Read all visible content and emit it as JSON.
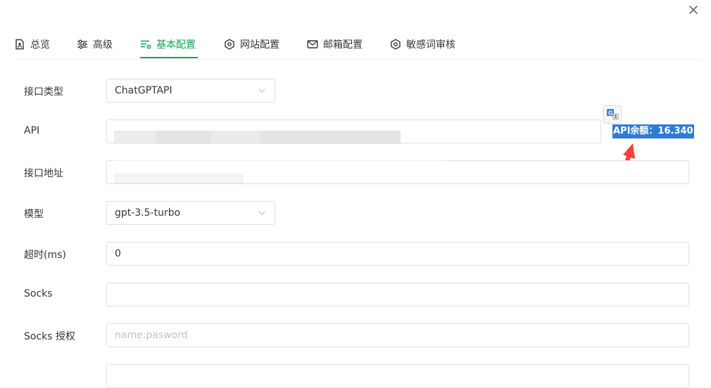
{
  "tabs": [
    {
      "label": "总览",
      "icon": "document-icon"
    },
    {
      "label": "高级",
      "icon": "sliders-icon"
    },
    {
      "label": "基本配置",
      "icon": "settings-list-icon",
      "active": true
    },
    {
      "label": "网站配置",
      "icon": "hexagon-gear-icon"
    },
    {
      "label": "邮箱配置",
      "icon": "mail-icon"
    },
    {
      "label": "敏感词审核",
      "icon": "hexagon-gear-icon"
    }
  ],
  "form": {
    "api_type": {
      "label": "接口类型",
      "value": "ChatGPTAPI"
    },
    "api": {
      "label": "API"
    },
    "endpoint": {
      "label": "接口地址"
    },
    "model": {
      "label": "模型",
      "value": "gpt-3.5-turbo"
    },
    "timeout": {
      "label": "超时(ms)",
      "value": "0"
    },
    "socks": {
      "label": "Socks",
      "value": ""
    },
    "socks_auth": {
      "label": "Socks 授权",
      "value": "",
      "placeholder": "name:pasword"
    }
  },
  "annotation": {
    "balance_text": "API余额：16.340",
    "highlight_color": "#2f7cd6",
    "arrow_color": "#f5413a"
  },
  "colors": {
    "accent": "#18a058",
    "border": "#e0e0e6"
  }
}
